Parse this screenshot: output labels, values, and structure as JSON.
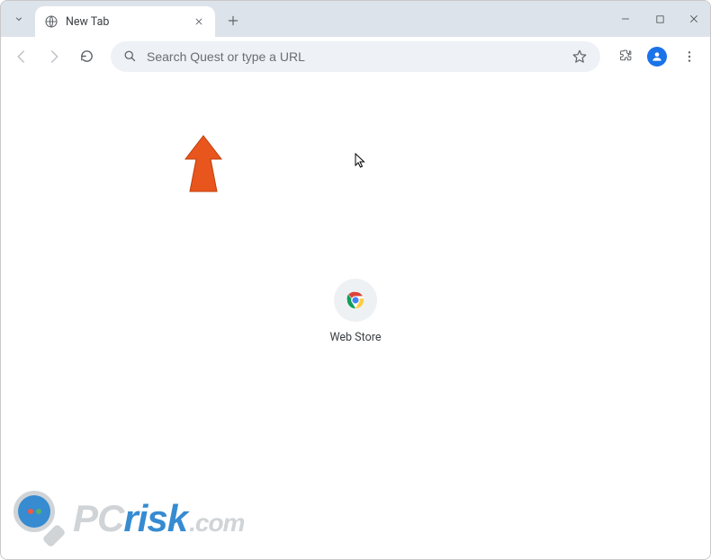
{
  "tab": {
    "title": "New Tab"
  },
  "omnibox": {
    "placeholder": "Search Quest or type a URL"
  },
  "shortcut": {
    "label": "Web Store"
  },
  "watermark": {
    "pc": "PC",
    "risk": "risk",
    "com": ".com"
  }
}
